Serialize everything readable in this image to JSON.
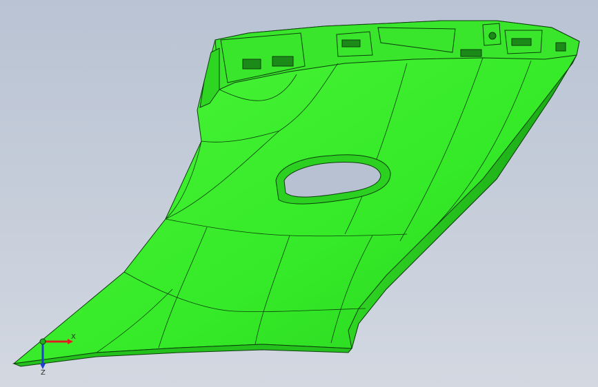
{
  "viewport": {
    "background_top": "#b9c3d3",
    "background_bottom": "#d3d8e1"
  },
  "model": {
    "part_color": "#3ef02e",
    "part_shade": "#1fb81a",
    "edge_color": "#0b3d0b"
  },
  "triad": {
    "x_label": "X",
    "z_label": "Z",
    "x_color": "#e02020",
    "y_color": "#20b020",
    "z_color": "#2040d0"
  }
}
